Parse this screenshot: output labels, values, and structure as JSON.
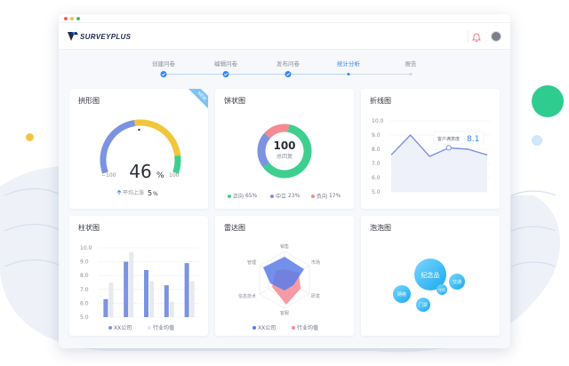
{
  "app": {
    "brand": "SURVEYPLUS"
  },
  "steps": [
    {
      "label": "创建问卷",
      "state": "done"
    },
    {
      "label": "编辑问卷",
      "state": "done"
    },
    {
      "label": "发布问卷",
      "state": "done"
    },
    {
      "label": "统计分析",
      "state": "current"
    },
    {
      "label": "报告",
      "state": "todo"
    }
  ],
  "cards": {
    "gauge": {
      "title": "拱形图",
      "badge": "NEW",
      "value": "46",
      "unit": "%",
      "fraction": 0.46,
      "min": "−100",
      "max": "100",
      "footer_label": "平均上涨",
      "footer_value": "5",
      "footer_unit": "%"
    },
    "pie": {
      "title": "饼状图",
      "center_value": "100",
      "center_label": "总回复",
      "legend": [
        {
          "label": "正向",
          "value": "65%",
          "color": "#3ecf8e"
        },
        {
          "label": "中立",
          "value": "23%",
          "color": "#7b93e0"
        },
        {
          "label": "负向",
          "value": "17%",
          "color": "#f58a93"
        }
      ]
    },
    "line": {
      "title": "折线图",
      "tooltip_label": "客户满意度",
      "tooltip_value": "8.1"
    },
    "bar": {
      "title": "柱状图",
      "legend": [
        {
          "label": "XX公司",
          "color": "#7b93e0"
        },
        {
          "label": "行业均值",
          "color": "#e6e9f0"
        }
      ]
    },
    "radar": {
      "title": "雷达图",
      "axes": [
        "销售",
        "市场",
        "研发",
        "客服",
        "信息技术",
        "管理"
      ],
      "legend": [
        {
          "label": "XX公司",
          "color": "#5a7de8"
        },
        {
          "label": "行业均值",
          "color": "#f58a93"
        }
      ]
    },
    "bubble": {
      "title": "泡泡图",
      "bubbles": [
        "纪念品",
        "网络",
        "交通",
        "门票",
        "住宿"
      ]
    }
  },
  "chart_data": [
    {
      "type": "line",
      "ylim": [
        5.0,
        10.0
      ],
      "y_ticks": [
        "10.0",
        "9.0",
        "8.0",
        "7.0",
        "6.0",
        "5.0"
      ],
      "values": [
        7.6,
        9.0,
        7.5,
        8.1,
        8.0,
        7.6
      ]
    },
    {
      "type": "bar",
      "ylim": [
        5.0,
        10.0
      ],
      "y_ticks": [
        "10.0",
        "9.0",
        "8.0",
        "7.0",
        "6.0",
        "5.0"
      ],
      "series": [
        {
          "name": "XX公司",
          "values": [
            6.3,
            9.0,
            8.4,
            7.3,
            8.9
          ]
        },
        {
          "name": "行业均值",
          "values": [
            7.5,
            9.7,
            7.6,
            6.1,
            7.6
          ]
        }
      ]
    },
    {
      "type": "pie",
      "slices": [
        {
          "label": "正向",
          "value": 65
        },
        {
          "label": "中立",
          "value": 23
        },
        {
          "label": "负向",
          "value": 17
        }
      ]
    }
  ]
}
